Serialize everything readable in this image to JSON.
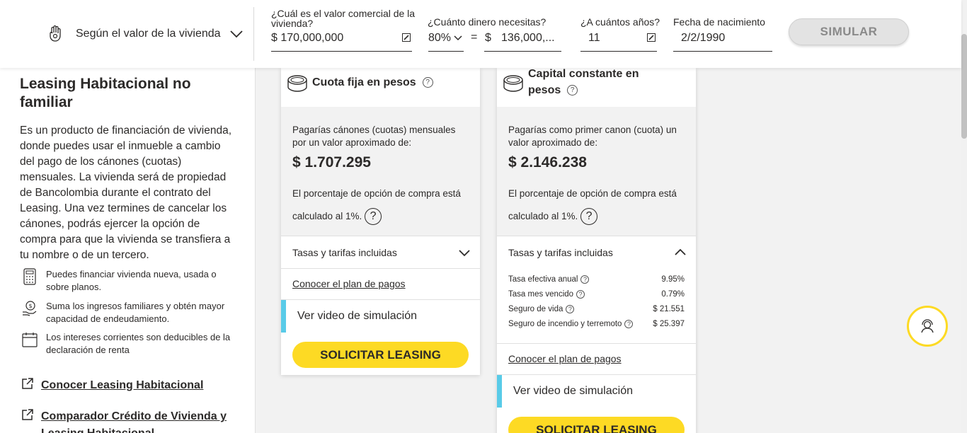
{
  "topbar": {
    "mode_label": "Según el valor de la vivienda",
    "valor_label": "¿Cuál es el valor comercial de la vivienda?",
    "valor_value": "$ 170,000,000",
    "dinero_label": "¿Cuánto dinero necesitas?",
    "percent_value": "80%",
    "equals": "=",
    "currency": "$",
    "amount_value": "136,000,...",
    "anios_label": "¿A cuántos años?",
    "anios_value": "11",
    "fecha_label": "Fecha de nacimiento",
    "fecha_value": "2/2/1990",
    "simular_label": "SIMULAR"
  },
  "left": {
    "title": "Leasing Habitacional no familiar",
    "description": "Es un producto de financiación de vivienda, donde puedes usar el inmueble a cambio del pago de los cánones (cuotas) mensuales. La vivienda será de propiedad de Bancolombia durante el contrato del Leasing. Una vez termines de cancelar los cánones, podrás ejercer la opción de compra para que la vivienda se transfiera a tu nombre o de un tercero.",
    "features": [
      {
        "icon": "calculator-icon",
        "text": "Puedes financiar vivienda nueva, usada o sobre planos."
      },
      {
        "icon": "money-hand-icon",
        "text": "Suma los ingresos familiares y obtén mayor capacidad de endeudamiento."
      },
      {
        "icon": "calendar-icon",
        "text": "Los intereses corrientes son deducibles de la declaración de renta"
      }
    ],
    "links": [
      {
        "text": "Conocer Leasing Habitacional"
      },
      {
        "text": "Comparador Crédito de Vivienda y Leasing Habitacional"
      }
    ]
  },
  "card1": {
    "title": "Cuota fija en pesos",
    "intro": "Pagarías cánones (cuotas) mensuales por un valor aproximado de:",
    "amount": "$ 1.707.295",
    "note": "El porcentaje de opción de compra está calculado al 1%.",
    "rates_label": "Tasas y tarifas incluidas",
    "plan_link": "Conocer el plan de pagos",
    "video_label": "Ver video de simulación",
    "cta": "SOLICITAR LEASING"
  },
  "card2": {
    "title": "Capital constante en pesos",
    "intro": "Pagarías como primer canon (cuota) un valor aproximado de:",
    "amount": "$ 2.146.238",
    "note": "El porcentaje de opción de compra está calculado al 1%.",
    "rates_label": "Tasas y tarifas incluidas",
    "rates": [
      {
        "name": "Tasa efectiva anual",
        "value": "9.95%"
      },
      {
        "name": "Tasa mes vencido",
        "value": "0.79%"
      },
      {
        "name": "Seguro de vida",
        "value": "$ 21.551"
      },
      {
        "name": "Seguro de incendio y terremoto",
        "value": "$ 25.397"
      }
    ],
    "plan_link": "Conocer el plan de pagos",
    "video_label": "Ver video de simulación",
    "cta": "SOLICITAR LEASING"
  },
  "colors": {
    "accent": "#fdda24",
    "video_bar": "#59cbe8",
    "text": "#2c2a29"
  }
}
